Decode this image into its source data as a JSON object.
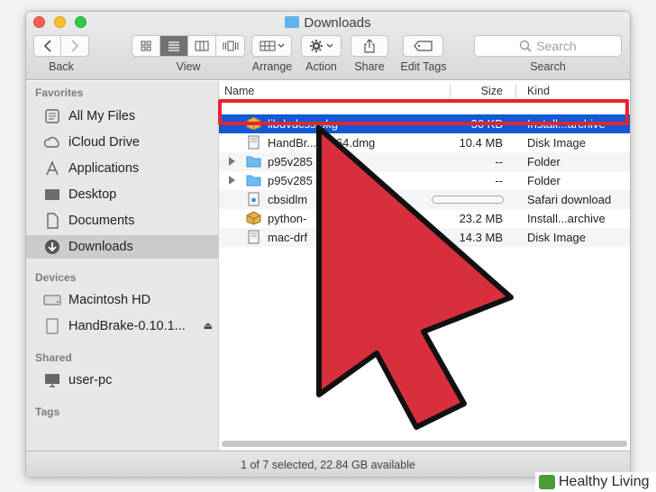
{
  "window": {
    "title": "Downloads"
  },
  "toolbar": {
    "back_label": "Back",
    "view_label": "View",
    "arrange_label": "Arrange",
    "action_label": "Action",
    "share_label": "Share",
    "edit_tags_label": "Edit Tags",
    "search_label": "Search",
    "search_placeholder": "Search"
  },
  "sidebar": {
    "sections": [
      {
        "title": "Favorites",
        "items": [
          {
            "label": "All My Files",
            "icon": "all-files-icon"
          },
          {
            "label": "iCloud Drive",
            "icon": "cloud-icon"
          },
          {
            "label": "Applications",
            "icon": "applications-icon"
          },
          {
            "label": "Desktop",
            "icon": "desktop-icon"
          },
          {
            "label": "Documents",
            "icon": "documents-icon"
          },
          {
            "label": "Downloads",
            "icon": "downloads-icon",
            "selected": true
          }
        ]
      },
      {
        "title": "Devices",
        "items": [
          {
            "label": "Macintosh HD",
            "icon": "hard-drive-icon"
          },
          {
            "label": "HandBrake-0.10.1...",
            "icon": "disk-image-icon",
            "eject": true
          }
        ]
      },
      {
        "title": "Shared",
        "items": [
          {
            "label": "user-pc",
            "icon": "computer-icon"
          }
        ]
      },
      {
        "title": "Tags",
        "items": []
      }
    ]
  },
  "columns": {
    "name": "Name",
    "size": "Size",
    "kind": "Kind"
  },
  "files": [
    {
      "name": "libdvdcss.pkg",
      "size": "36 KB",
      "kind": "Install...archive",
      "icon": "package-icon",
      "selected": true
    },
    {
      "name": "HandBrake-0.10.1-x86_64.dmg",
      "display": "HandBr...86_64.dmg",
      "size": "10.4 MB",
      "kind": "Disk Image",
      "icon": "disk-image-icon"
    },
    {
      "name": "p95v285",
      "display": "p95v285",
      "size": "--",
      "kind": "Folder",
      "icon": "folder-icon",
      "expandable": true
    },
    {
      "name": "p95v285",
      "display": "p95v285",
      "size": "--",
      "kind": "Folder",
      "icon": "folder-icon",
      "expandable": true
    },
    {
      "name": "cbsidlm",
      "display": "cbsidlm",
      "size": "",
      "kind": "Safari download",
      "icon": "download-file-icon",
      "progress": 0
    },
    {
      "name": "python-",
      "display": "python-",
      "size": "23.2 MB",
      "kind": "Install...archive",
      "icon": "package-icon"
    },
    {
      "name": "mac-drf",
      "display": "mac-drf",
      "size": "14.3 MB",
      "kind": "Disk Image",
      "icon": "disk-image-icon"
    }
  ],
  "status": {
    "text": "1 of 7 selected, 22.84 GB available"
  },
  "watermark": {
    "brand": "Healthy Living"
  },
  "colors": {
    "selection": "#1159d6",
    "highlight_box": "#e4262d",
    "pointer_arrow": "#d82f3c"
  }
}
